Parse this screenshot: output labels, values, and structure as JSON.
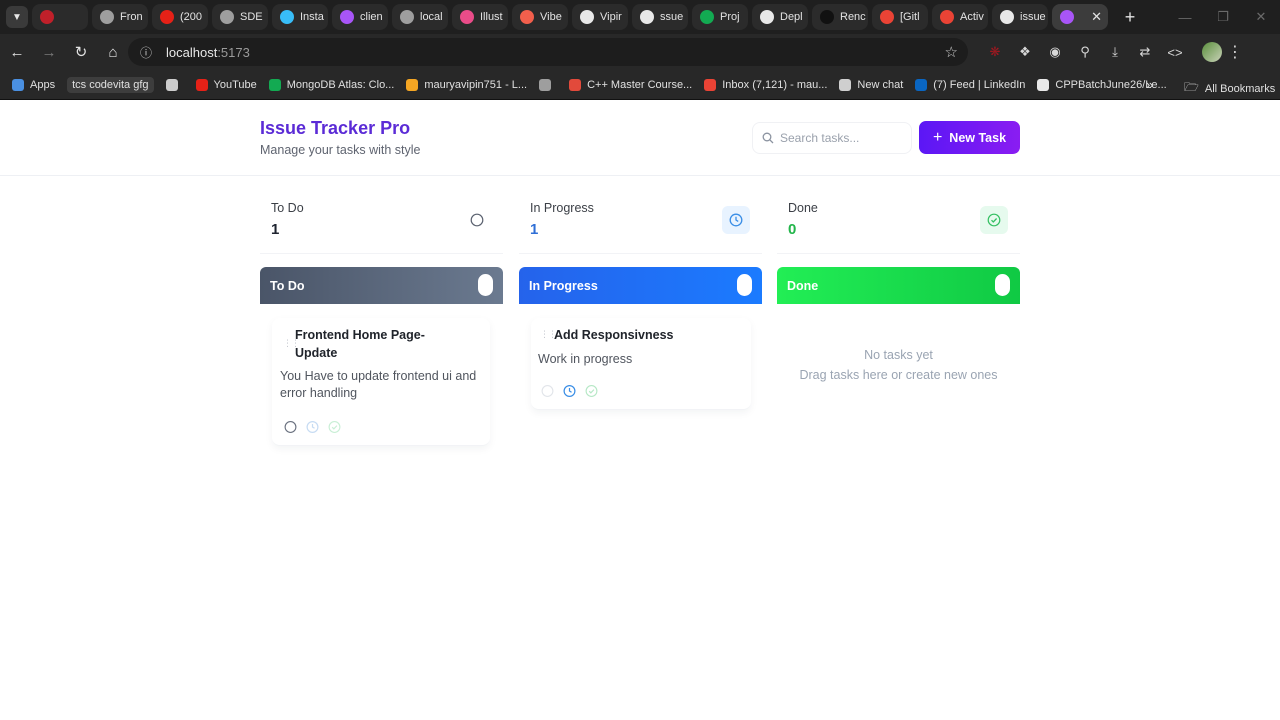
{
  "browser": {
    "tabs": [
      {
        "label": "",
        "color": "#c0202a",
        "icon": "spider-icon"
      },
      {
        "label": "Fron",
        "color": "#9e9e9e",
        "icon": "chatgpt-icon"
      },
      {
        "label": "(200",
        "color": "#e62117",
        "icon": "youtube-icon"
      },
      {
        "label": "SDE",
        "color": "#9e9e9e",
        "icon": "globe-icon"
      },
      {
        "label": "Insta",
        "color": "#38bdf8",
        "icon": "tailwind-icon"
      },
      {
        "label": "clien",
        "color": "#a855f7",
        "icon": "vite-icon"
      },
      {
        "label": "local",
        "color": "#9e9e9e",
        "icon": "globe-icon"
      },
      {
        "label": "Illust",
        "color": "#ea4c89",
        "icon": "dribbble-icon"
      },
      {
        "label": "Vibe",
        "color": "#f25f4c",
        "icon": "spark-icon"
      },
      {
        "label": "Vipir",
        "color": "#e8e8e8",
        "icon": "github-icon"
      },
      {
        "label": "ssue",
        "color": "#e8e8e8",
        "icon": "github-icon"
      },
      {
        "label": "Proj",
        "color": "#13aa52",
        "icon": "mongodb-icon"
      },
      {
        "label": "Depl",
        "color": "#e8e8e8",
        "icon": "render-icon"
      },
      {
        "label": "Renc",
        "color": "#111111",
        "icon": "render-icon"
      },
      {
        "label": "[Gitl",
        "color": "#ea4335",
        "icon": "gmail-icon"
      },
      {
        "label": "Activ",
        "color": "#ea4335",
        "icon": "gmail-icon"
      },
      {
        "label": "issue",
        "color": "#e8e8e8",
        "icon": "app-icon"
      },
      {
        "label": "",
        "color": "#a855f7",
        "icon": "vite-icon",
        "active": true
      }
    ],
    "url_host": "localhost",
    "url_port": ":5173",
    "bookmarks": [
      {
        "label": "Apps",
        "color": "#4a90e2",
        "icon": "apps-grid-icon"
      },
      {
        "label": "tcs codevita gfg",
        "color": "",
        "icon": "",
        "chip": true
      },
      {
        "label": "",
        "color": "#cccccc",
        "icon": "grid-icon"
      },
      {
        "label": "YouTube",
        "color": "#e62117",
        "icon": "youtube-icon"
      },
      {
        "label": "MongoDB Atlas: Clo...",
        "color": "#13aa52",
        "icon": "mongodb-icon"
      },
      {
        "label": "mauryavipin751 - L...",
        "color": "#f5a623",
        "icon": "leetcode-icon"
      },
      {
        "label": "",
        "color": "#9e9e9e",
        "icon": "globe-icon"
      },
      {
        "label": "C++ Master Course...",
        "color": "#e24a3b",
        "icon": "course-icon"
      },
      {
        "label": "Inbox (7,121) - mau...",
        "color": "#ea4335",
        "icon": "gmail-icon"
      },
      {
        "label": "New chat",
        "color": "#cfcfcf",
        "icon": "chatgpt-icon"
      },
      {
        "label": "(7) Feed | LinkedIn",
        "color": "#0a66c2",
        "icon": "linkedin-icon"
      },
      {
        "label": "CPPBatchJune26/Le...",
        "color": "#e8e8e8",
        "icon": "github-icon"
      }
    ],
    "all_bookmarks": "All Bookmarks"
  },
  "app": {
    "title": "Issue Tracker Pro",
    "subtitle": "Manage your tasks with style",
    "search_placeholder": "Search tasks...",
    "new_task_label": "New Task"
  },
  "stats": [
    {
      "label": "To Do",
      "count": "1",
      "color": "#1f2430",
      "icon": "circle-icon"
    },
    {
      "label": "In Progress",
      "count": "1",
      "color": "#2f6fd6",
      "icon": "clock-icon"
    },
    {
      "label": "Done",
      "count": "0",
      "color": "#22b54a",
      "icon": "check-circle-icon"
    }
  ],
  "columns": [
    {
      "title": "To Do",
      "gradient": [
        "#4a5568",
        "#6b7a90"
      ]
    },
    {
      "title": "In Progress",
      "gradient": [
        "#2563eb",
        "#1b7bff"
      ]
    },
    {
      "title": "Done",
      "gradient": [
        "#22ee55",
        "#10c944"
      ]
    }
  ],
  "cards": [
    {
      "column": 0,
      "title_line1": "Frontend Home Page-",
      "title_line2": "Update",
      "desc_line1": "You Have to update frontend ui and",
      "desc_line2": "error handling"
    },
    {
      "column": 1,
      "title_line1": "Add Responsivness",
      "desc_line1": "Work in progress"
    }
  ],
  "empty_state": {
    "line1": "No tasks yet",
    "line2": "Drag tasks here or create new ones"
  }
}
